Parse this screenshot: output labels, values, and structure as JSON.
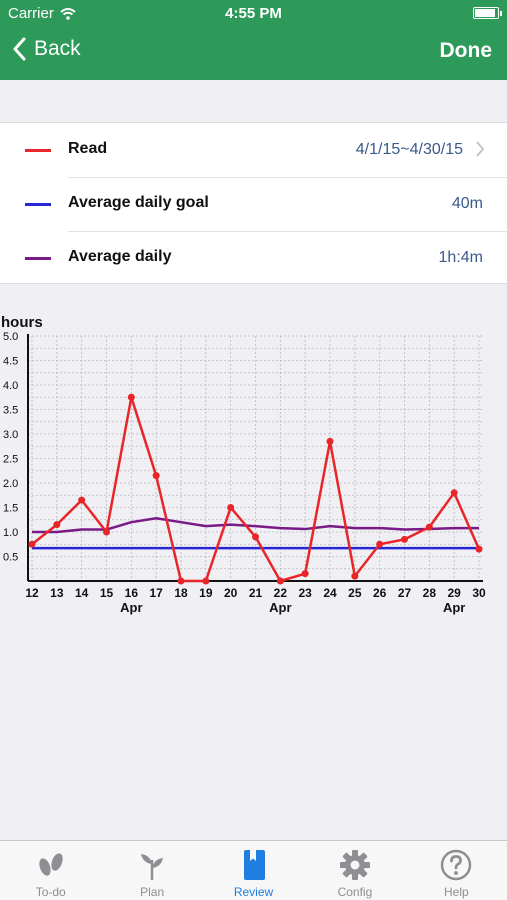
{
  "status_bar": {
    "carrier": "Carrier",
    "time": "4:55 PM",
    "battery_level": 0.95
  },
  "nav": {
    "back_label": "Back",
    "done_label": "Done"
  },
  "legend": [
    {
      "label": "Read",
      "value": "4/1/15~4/30/15",
      "color": "#e8262a"
    },
    {
      "label": "Average daily goal",
      "value": "40m",
      "color": "#2727d8"
    },
    {
      "label": "Average daily",
      "value": "1h:4m",
      "color": "#7a1a86"
    }
  ],
  "chart_data": {
    "type": "line",
    "ylabel": "hours",
    "ylim": [
      0,
      5.0
    ],
    "y_ticks": [
      "0.5",
      "1.0",
      "1.5",
      "2.0",
      "2.5",
      "3.0",
      "3.5",
      "4.0",
      "4.5",
      "5.0"
    ],
    "x": [
      "12",
      "13",
      "14",
      "15",
      "16",
      "17",
      "18",
      "19",
      "20",
      "21",
      "22",
      "23",
      "24",
      "25",
      "26",
      "27",
      "28",
      "29",
      "30"
    ],
    "month_labels": [
      {
        "at": "16",
        "label": "Apr"
      },
      {
        "at": "22",
        "label": "Apr"
      },
      {
        "at": "29",
        "label": "Apr"
      }
    ],
    "grid": true,
    "series": [
      {
        "name": "Read",
        "color": "#e8262a",
        "markers": true,
        "values": [
          0.75,
          1.15,
          1.65,
          1.0,
          3.75,
          2.15,
          0.0,
          0.0,
          1.5,
          0.9,
          0.0,
          0.15,
          2.85,
          0.1,
          0.75,
          0.85,
          1.1,
          1.8,
          0.65
        ]
      },
      {
        "name": "Average daily goal",
        "color": "#2727d8",
        "markers": false,
        "values": [
          0.67,
          0.67,
          0.67,
          0.67,
          0.67,
          0.67,
          0.67,
          0.67,
          0.67,
          0.67,
          0.67,
          0.67,
          0.67,
          0.67,
          0.67,
          0.67,
          0.67,
          0.67,
          0.67
        ]
      },
      {
        "name": "Average daily",
        "color": "#7a1a86",
        "markers": false,
        "values": [
          1.0,
          1.0,
          1.05,
          1.05,
          1.2,
          1.28,
          1.2,
          1.12,
          1.15,
          1.12,
          1.08,
          1.06,
          1.12,
          1.08,
          1.08,
          1.05,
          1.06,
          1.08,
          1.08
        ]
      }
    ]
  },
  "tabs": [
    {
      "label": "To-do",
      "icon": "footprints-icon",
      "active": false
    },
    {
      "label": "Plan",
      "icon": "sprout-icon",
      "active": false
    },
    {
      "label": "Review",
      "icon": "book-icon",
      "active": true
    },
    {
      "label": "Config",
      "icon": "gear-icon",
      "active": false
    },
    {
      "label": "Help",
      "icon": "help-circle-icon",
      "active": false
    }
  ]
}
